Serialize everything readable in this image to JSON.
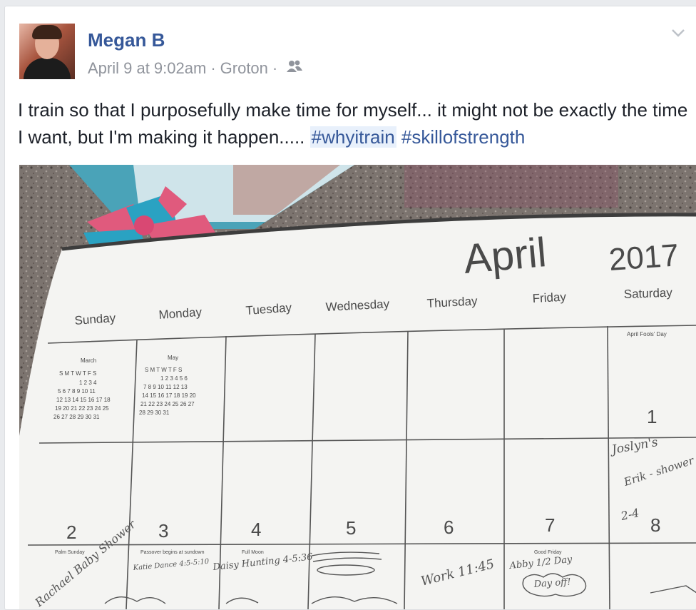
{
  "post": {
    "author": "Megan B",
    "date": "April 9 at 9:02am",
    "location": "Groton",
    "separator": "·",
    "text": "I train so that I purposefully make time for myself... it might not be exactly the time I want, but I'm making it happen..... ",
    "hashtags": [
      "#whyitrain",
      "#skillofstrength"
    ]
  },
  "icons": {
    "audience": "friends-icon",
    "menu": "chevron-down-icon"
  },
  "colors": {
    "link": "#365899",
    "meta": "#90949c",
    "text": "#1d2129"
  },
  "calendar": {
    "month": "April",
    "year": "2017",
    "weekdays": [
      "Sunday",
      "Monday",
      "Tuesday",
      "Wednesday",
      "Thursday",
      "Friday",
      "Saturday"
    ],
    "mini_prev": {
      "title": "March",
      "days": "S M T W T F S",
      "rows": [
        "1 2 3 4",
        "5 6 7 8 9 10 11",
        "12 13 14 15 16 17 18",
        "19 20 21 22 23 24 25",
        "26 27 28 29 30 31"
      ]
    },
    "mini_next": {
      "title": "May",
      "days": "S M T W T F S",
      "rows": [
        "1 2 3 4 5 6",
        "7 8 9 10 11 12 13",
        "14 15 16 17 18 19 20",
        "21 22 23 24 25 26 27",
        "28 29 30 31"
      ]
    },
    "holiday_sat1": "April Fools' Day",
    "day1": "1",
    "row2_days": [
      "2",
      "3",
      "4",
      "5",
      "6",
      "7",
      "8"
    ],
    "events": {
      "palm": "Palm Sunday",
      "passover": "Passover begins at sundown",
      "fullmoon": "Full Moon",
      "goodfriday": "Good Friday"
    },
    "handwriting": {
      "sat1": "Joslyn's",
      "sat1b": "Erik - shower",
      "sat1c": "2-4",
      "sun2": "Rachael Baby Shower",
      "mon3": "Katie Dance 4:5-5:10",
      "tue4": "Daisy Hunting 4-5:36",
      "thu6": "Work 11:45",
      "fri7a": "Abby 1/2 Day",
      "fri7b": "Day off!"
    }
  }
}
